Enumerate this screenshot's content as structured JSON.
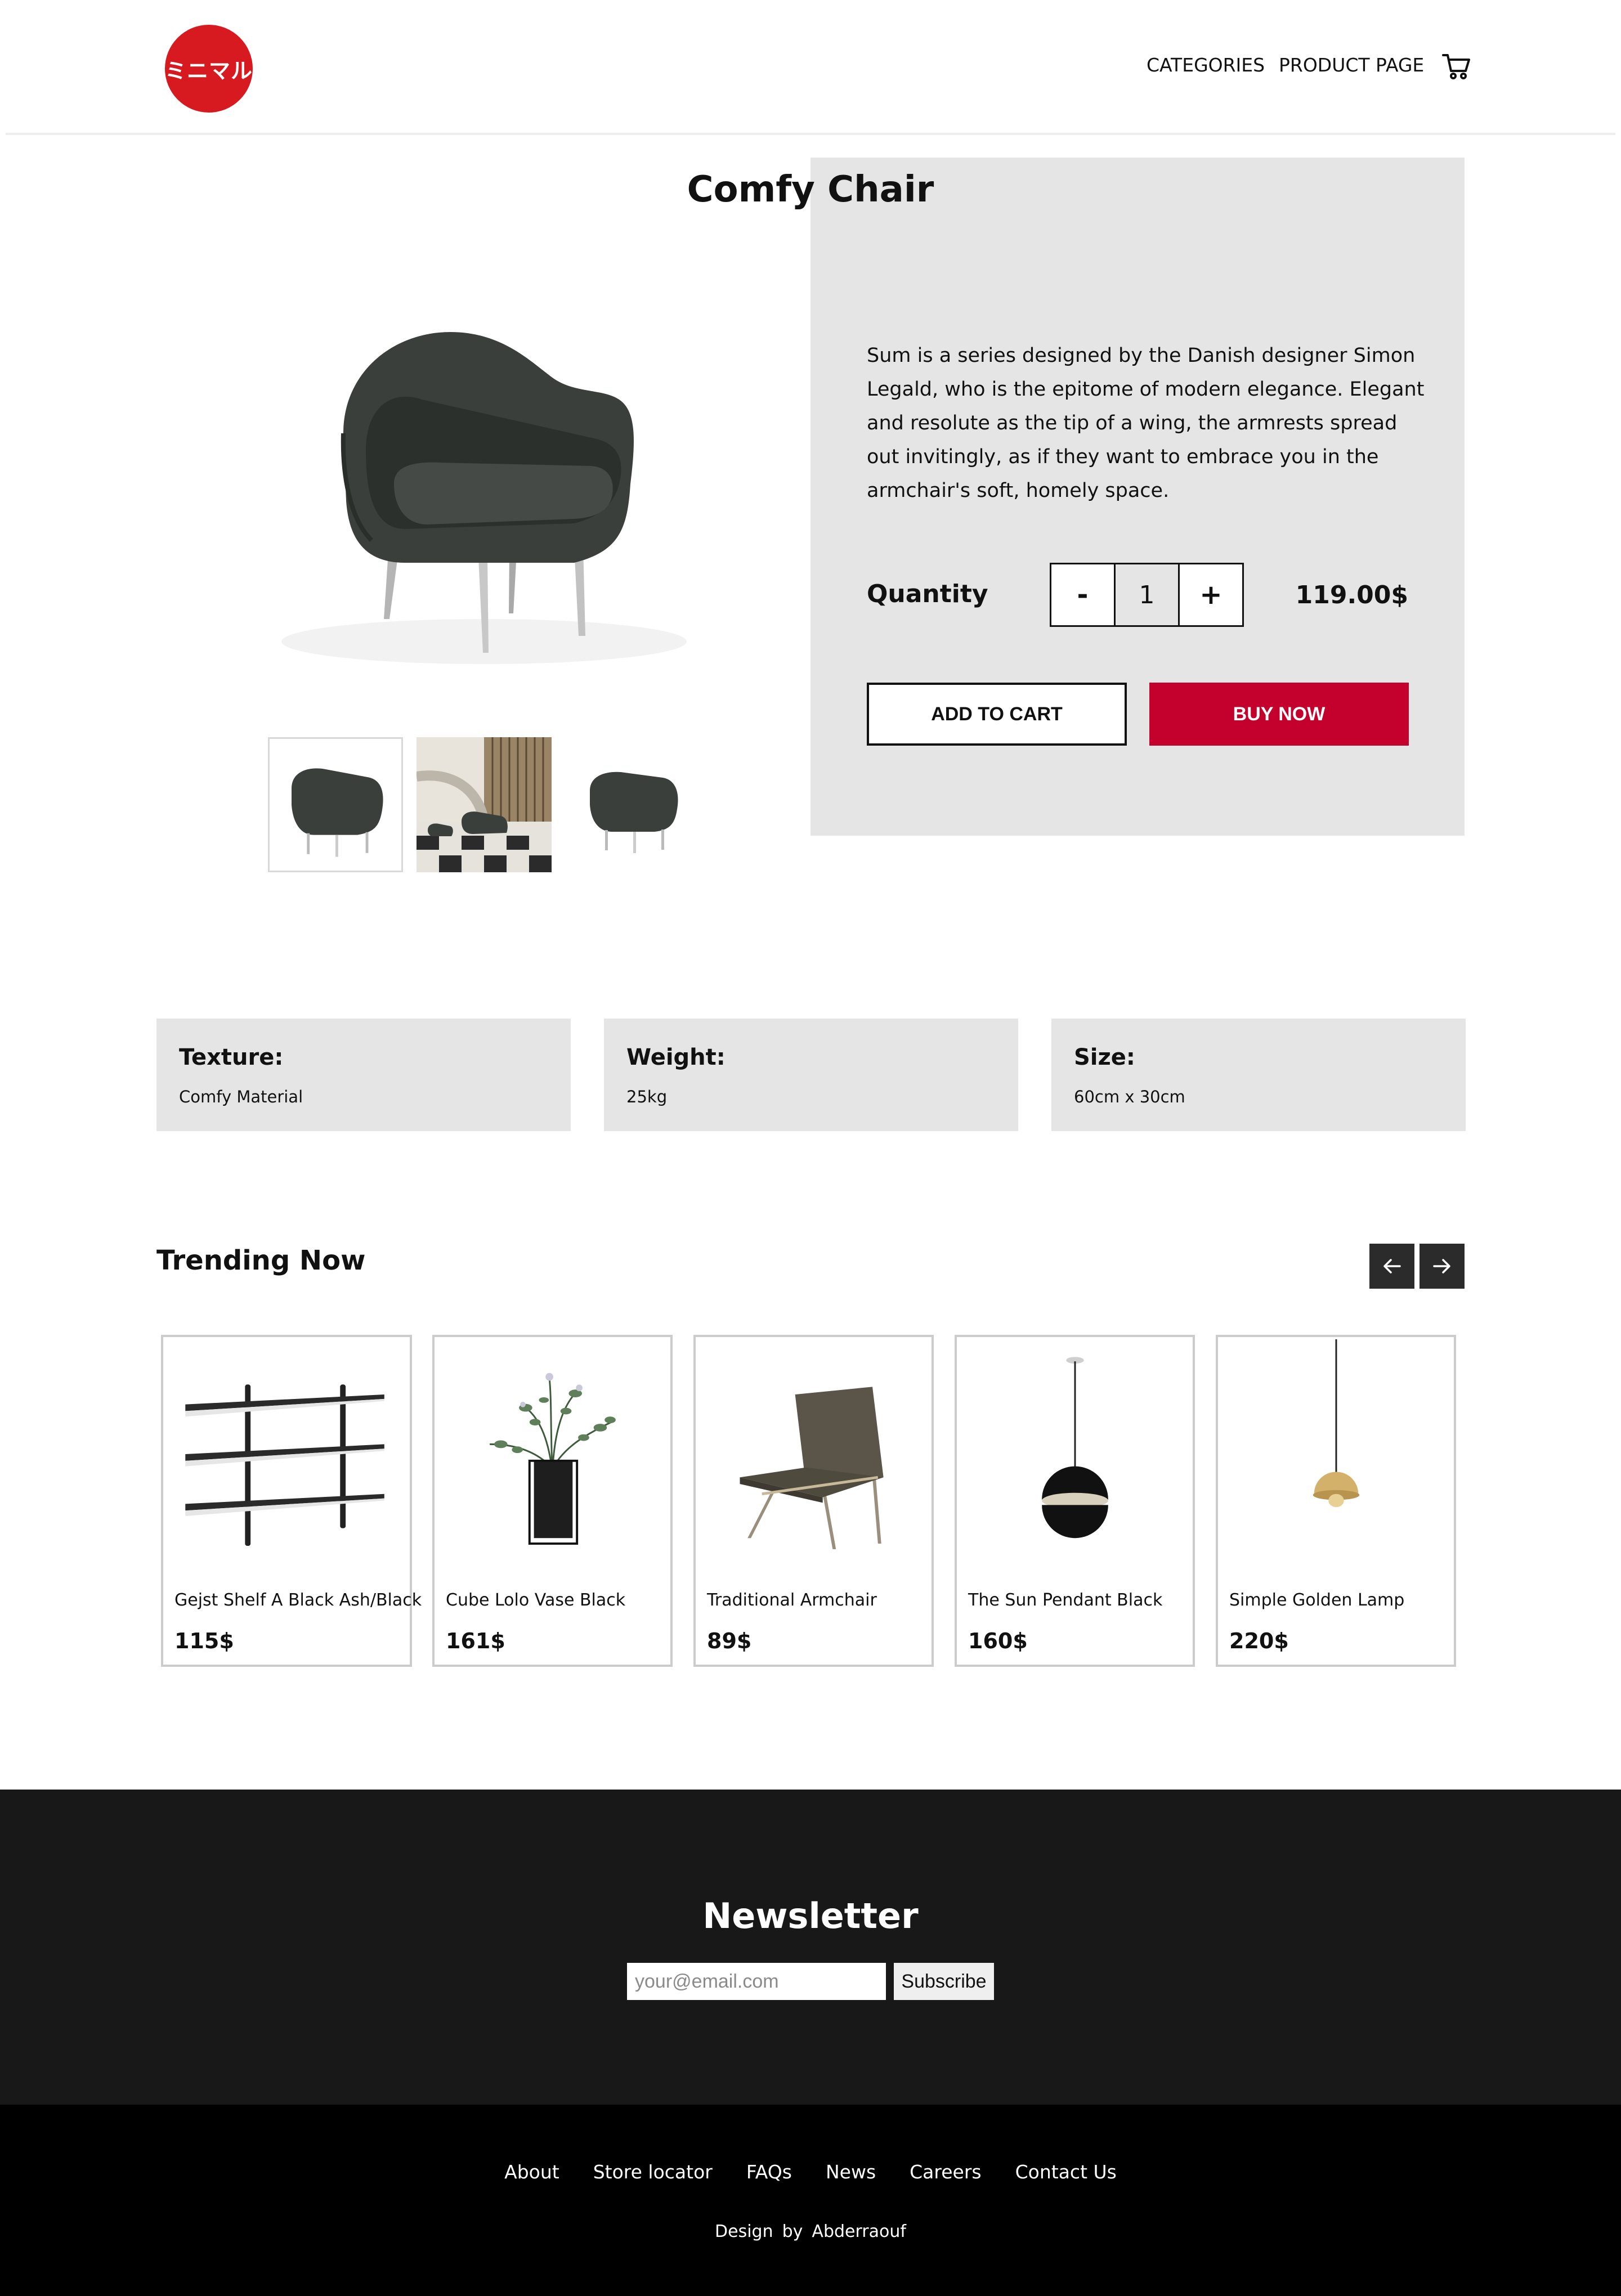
{
  "header": {
    "logo_text": "ミニマル",
    "nav": {
      "categories": "CATEGORIES",
      "product_page": "PRODUCT PAGE"
    },
    "cart_icon": "cart-icon"
  },
  "product": {
    "title": "Comfy Chair",
    "description": "Sum is a series designed by the Danish designer Simon Legald, who is the epitome of modern elegance. Elegant and resolute as the tip of a wing, the armrests spread out invitingly, as if they want to embrace you in the armchair's soft, homely space.",
    "quantity_label": "Quantity",
    "quantity_minus": "-",
    "quantity_value": "1",
    "quantity_plus": "+",
    "price": "119.00$",
    "add_to_cart": "ADD TO CART",
    "buy_now": "BUY NOW",
    "accent_color": "#c4002c"
  },
  "specs": [
    {
      "label": "Texture:",
      "value": "Comfy Material"
    },
    {
      "label": "Weight:",
      "value": "25kg"
    },
    {
      "label": "Size:",
      "value": "60cm x 30cm"
    }
  ],
  "trending": {
    "title": "Trending Now",
    "prev_icon": "arrow-left-icon",
    "next_icon": "arrow-right-icon",
    "items": [
      {
        "name": "Gejst Shelf A Black Ash/Black",
        "price": "115$"
      },
      {
        "name": "Cube Lolo Vase Black",
        "price": "161$"
      },
      {
        "name": "Traditional Armchair",
        "price": "89$"
      },
      {
        "name": "The Sun Pendant Black",
        "price": "160$"
      },
      {
        "name": "Simple Golden Lamp",
        "price": "220$"
      }
    ]
  },
  "newsletter": {
    "title": "Newsletter",
    "placeholder": "your@email.com",
    "button": "Subscribe"
  },
  "footer": {
    "links": [
      "About",
      "Store locator",
      "FAQs",
      "News",
      "Careers",
      "Contact Us"
    ],
    "credit_prefix": "Design",
    "credit_by": "by",
    "credit_name": "Abderraouf"
  }
}
